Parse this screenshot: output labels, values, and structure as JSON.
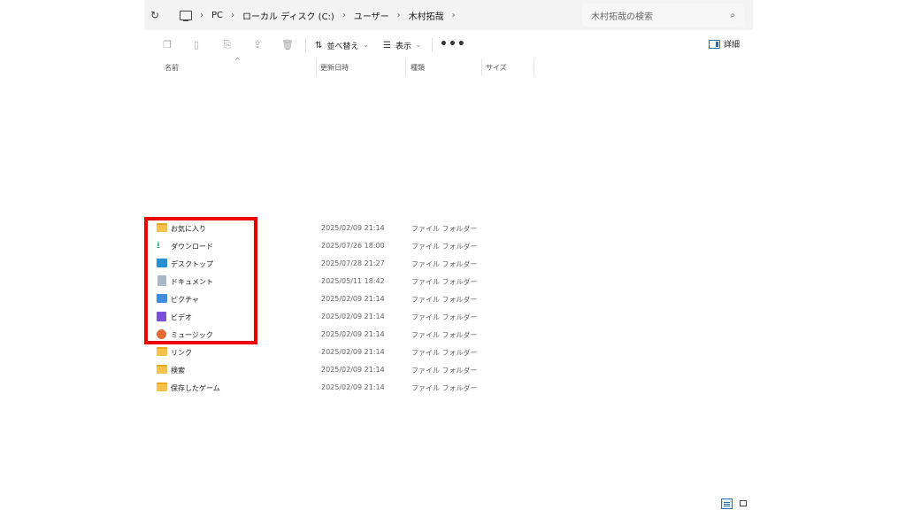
{
  "address_bar": {
    "breadcrumbs": [
      "PC",
      "ローカル ディスク (C:)",
      "ユーザー",
      "木村拓哉"
    ],
    "search_placeholder": "木村拓哉の検索"
  },
  "toolbar": {
    "sort_label": "並べ替え",
    "view_label": "表示",
    "more_label": "•••",
    "details_label": "詳細"
  },
  "columns": {
    "name": "名前",
    "modified": "更新日時",
    "type": "種類",
    "size": "サイズ"
  },
  "files": [
    {
      "name": "お気に入り",
      "date": "2025/02/09 21:14",
      "type": "ファイル フォルダー",
      "icon": "folder-icon"
    },
    {
      "name": "ダウンロード",
      "date": "2025/07/26 18:00",
      "type": "ファイル フォルダー",
      "icon": "download-icon"
    },
    {
      "name": "デスクトップ",
      "date": "2025/07/28 21:27",
      "type": "ファイル フォルダー",
      "icon": "desktop-icon"
    },
    {
      "name": "ドキュメント",
      "date": "2025/05/11 18:42",
      "type": "ファイル フォルダー",
      "icon": "documents-icon"
    },
    {
      "name": "ピクチャ",
      "date": "2025/02/09 21:14",
      "type": "ファイル フォルダー",
      "icon": "pictures-icon"
    },
    {
      "name": "ビデオ",
      "date": "2025/02/09 21:14",
      "type": "ファイル フォルダー",
      "icon": "videos-icon"
    },
    {
      "name": "ミュージック",
      "date": "2025/02/09 21:14",
      "type": "ファイル フォルダー",
      "icon": "music-icon"
    },
    {
      "name": "リンク",
      "date": "2025/02/09 21:14",
      "type": "ファイル フォルダー",
      "icon": "folder-icon"
    },
    {
      "name": "検索",
      "date": "2025/02/09 21:14",
      "type": "ファイル フォルダー",
      "icon": "folder-icon"
    },
    {
      "name": "保存したゲーム",
      "date": "2025/02/09 21:14",
      "type": "ファイル フォルダー",
      "icon": "folder-icon"
    }
  ],
  "highlight_color": "#ee0000",
  "accent_color": "#1f6fb2"
}
